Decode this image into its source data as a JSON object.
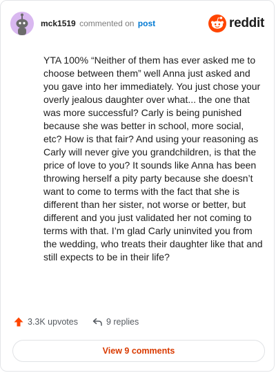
{
  "comment": {
    "author": "mck1519",
    "action_text": "commented on",
    "target_link": "post",
    "body": "YTA 100% “Neither of them has ever asked me to choose between them” well Anna just asked and you gave into her immediately. You just chose your overly jealous daughter over what... the one that was more successful? Carly is being punished because she was better in school, more social, etc? How is that fair? And using your reasoning as Carly will never give you grandchildren, is that the price of love to you? It sounds like Anna has been throwing herself a pity party because she doesn’t want to come to terms with the fact that she is different than her sister, not worse or better, but different and you just validated her not coming to terms with that. I’m glad Carly uninvited you from the wedding, who treats their daughter like that and still expects to be in their life?",
    "upvotes": "3.3K upvotes",
    "replies": "9 replies",
    "view_comments": "View 9 comments"
  },
  "brand": {
    "name": "reddit",
    "color": "#ff4500"
  },
  "icons": {
    "avatar": "snoo-avatar-icon",
    "logo": "reddit-logo-icon",
    "upvote": "upvote-arrow-icon",
    "reply": "reply-arrow-icon"
  },
  "colors": {
    "link": "#0079d3",
    "accent": "#d93a00",
    "avatar_bg": "#d9b8f0",
    "upvote": "#ff4500"
  }
}
